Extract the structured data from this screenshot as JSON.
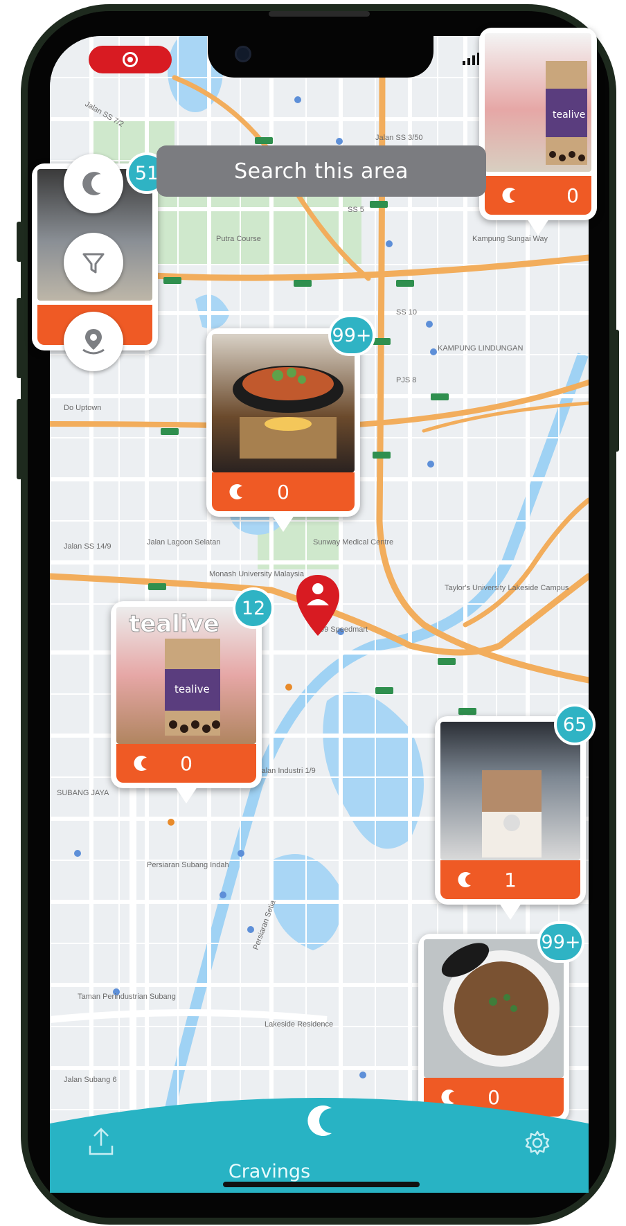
{
  "recording_indicator": "record-icon",
  "status_icons": [
    "signal-icon",
    "wifi-icon",
    "battery-icon"
  ],
  "search_area_button": "Search this area",
  "side_buttons": [
    "cravings-logo-icon",
    "filter-icon",
    "location-pin-icon"
  ],
  "map_labels": {
    "road1": "Jalan SS 7/2",
    "road2": "Jalan SS 3/50",
    "road3": "SS 5",
    "road4": "SS 10",
    "road5": "PJS 8",
    "road6": "Jalan Lagoon Selatan",
    "road7": "Jalan Industri 1/9",
    "road8": "Persiaran Subang Indah",
    "road9": "Jalan SS 14/9",
    "road10": "Persiaran Setia",
    "place1": "Putra Course",
    "place2": "KAMPUNG LINDUNGAN",
    "place3": "Sunway Medical Centre",
    "place4": "Taylor's University Lakeside Campus",
    "place5": "Lakeside Residence",
    "place6": "Do Uptown",
    "place7": "Monash University Malaysia",
    "place8": "Kampung Sungai Way",
    "shop1": "99 Speedmart",
    "area1": "SUBANG JAYA",
    "area2": "Taman Perindustrian Subang",
    "road11": "Jalan Subang 6"
  },
  "markers": [
    {
      "badge": "51",
      "count": "",
      "photo": "office-photo"
    },
    {
      "badge": "",
      "count": "0",
      "photo": "bubble-tea-photo"
    },
    {
      "badge": "99+",
      "count": "0",
      "photo": "hotpot-photo"
    },
    {
      "badge": "12",
      "count": "0",
      "photo": "tealive-photo"
    },
    {
      "badge": "65",
      "count": "1",
      "photo": "iced-latte-photo"
    },
    {
      "badge": "99+",
      "count": "0",
      "photo": "noodle-bowl-photo"
    }
  ],
  "tealive_text": "tealive",
  "tealive_sign": "tealive",
  "tabs": {
    "upload_icon": "upload-icon",
    "center_label": "Cravings",
    "settings_icon": "gear-icon"
  },
  "colors": {
    "accent": "#2fb3c4",
    "bar": "#ef5a25",
    "pin": "#d81b22"
  }
}
